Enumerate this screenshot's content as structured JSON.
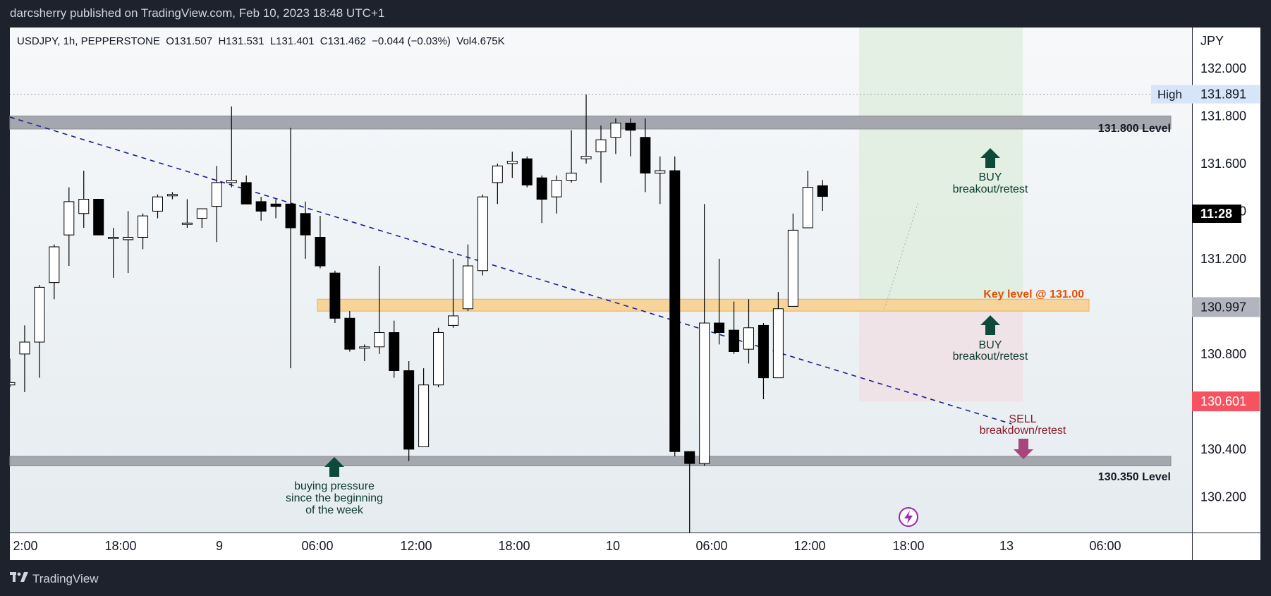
{
  "header": {
    "publisher": "darcsherry published on TradingView.com, Feb 10, 2023 18:48 UTC+1"
  },
  "legend": {
    "symbol": "USDJPY, 1h, PEPPERSTONE",
    "open": "O131.507",
    "high": "H131.531",
    "low": "L131.401",
    "close": "C131.462",
    "change": "−0.044 (−0.03%)",
    "volume": "Vol4.675K"
  },
  "axis": {
    "currency": "JPY",
    "price_ticks": [
      "130.200",
      "130.400",
      "130.800",
      "131.200",
      "131.400",
      "131.600",
      "131.800",
      "132.000"
    ],
    "time_ticks": [
      "2:00",
      "18:00",
      "9",
      "06:00",
      "12:00",
      "18:00",
      "10",
      "06:00",
      "12:00",
      "18:00",
      "13",
      "06:00"
    ]
  },
  "price_badges": [
    {
      "label": "High",
      "value": "131.891",
      "bg": "#d6e5f8",
      "fg": "#131722"
    },
    {
      "value": "11:28",
      "bg": "#000000",
      "fg": "#ffffff"
    },
    {
      "value": "130.997",
      "bg": "#b2b5be",
      "fg": "#131722"
    },
    {
      "value": "130.601",
      "bg": "#f7525f",
      "fg": "#ffffff"
    }
  ],
  "annotations": {
    "level_high": "131.800 Level",
    "level_low": "130.350 Level",
    "key_level": "Key level @ 131.00",
    "buy_top_1": "BUY",
    "buy_top_2": "breakout/retest",
    "buy_mid_1": "BUY",
    "buy_mid_2": "breakout/retest",
    "sell_1": "SELL",
    "sell_2": "breakdown/retest",
    "pressure_1": "buying pressure",
    "pressure_2": "since the beginning",
    "pressure_3": "of the week"
  },
  "footer": {
    "brand": "TradingView"
  },
  "colors": {
    "bull_body": "#ffffff",
    "bear_body": "#000000",
    "zone_gray": "#a4a7ad",
    "key_zone": "#f7d49a",
    "key_text": "#e65100",
    "buy_arrow": "#0d4a3a",
    "sell_arrow": "#a8457a",
    "sell_text": "#8b1a2a",
    "trendline": "#1a1f8c",
    "profit_zone": "#d9ebd6",
    "loss_zone": "#f0e0e3"
  },
  "chart_data": {
    "type": "candlestick",
    "symbol": "USDJPY",
    "interval": "1h",
    "exchange": "PEPPERSTONE",
    "ylim": [
      130.05,
      132.17
    ],
    "candles": [
      {
        "o": 130.67,
        "h": 130.78,
        "l": 130.66,
        "c": 130.68
      },
      {
        "o": 130.8,
        "h": 130.92,
        "l": 130.64,
        "c": 130.85
      },
      {
        "o": 130.85,
        "h": 131.09,
        "l": 130.7,
        "c": 131.08
      },
      {
        "o": 131.1,
        "h": 131.26,
        "l": 131.03,
        "c": 131.25
      },
      {
        "o": 131.3,
        "h": 131.5,
        "l": 131.17,
        "c": 131.44
      },
      {
        "o": 131.39,
        "h": 131.57,
        "l": 131.33,
        "c": 131.45
      },
      {
        "o": 131.45,
        "h": 131.45,
        "l": 131.3,
        "c": 131.3
      },
      {
        "o": 131.29,
        "h": 131.33,
        "l": 131.12,
        "c": 131.29
      },
      {
        "o": 131.28,
        "h": 131.4,
        "l": 131.14,
        "c": 131.29
      },
      {
        "o": 131.29,
        "h": 131.39,
        "l": 131.24,
        "c": 131.38
      },
      {
        "o": 131.4,
        "h": 131.47,
        "l": 131.37,
        "c": 131.46
      },
      {
        "o": 131.47,
        "h": 131.48,
        "l": 131.45,
        "c": 131.47
      },
      {
        "o": 131.35,
        "h": 131.45,
        "l": 131.33,
        "c": 131.35
      },
      {
        "o": 131.37,
        "h": 131.41,
        "l": 131.33,
        "c": 131.41
      },
      {
        "o": 131.42,
        "h": 131.59,
        "l": 131.27,
        "c": 131.52
      },
      {
        "o": 131.52,
        "h": 131.84,
        "l": 131.5,
        "c": 131.53
      },
      {
        "o": 131.52,
        "h": 131.55,
        "l": 131.43,
        "c": 131.43
      },
      {
        "o": 131.44,
        "h": 131.46,
        "l": 131.36,
        "c": 131.4
      },
      {
        "o": 131.43,
        "h": 131.45,
        "l": 131.37,
        "c": 131.42
      },
      {
        "o": 131.43,
        "h": 131.75,
        "l": 130.74,
        "c": 131.33
      },
      {
        "o": 131.39,
        "h": 131.44,
        "l": 131.2,
        "c": 131.3
      },
      {
        "o": 131.29,
        "h": 131.38,
        "l": 131.16,
        "c": 131.17
      },
      {
        "o": 131.14,
        "h": 131.15,
        "l": 130.93,
        "c": 130.95
      },
      {
        "o": 130.95,
        "h": 130.98,
        "l": 130.81,
        "c": 130.82
      },
      {
        "o": 130.83,
        "h": 130.84,
        "l": 130.77,
        "c": 130.83
      },
      {
        "o": 130.83,
        "h": 131.17,
        "l": 130.8,
        "c": 130.89
      },
      {
        "o": 130.89,
        "h": 130.94,
        "l": 130.7,
        "c": 130.73
      },
      {
        "o": 130.73,
        "h": 130.77,
        "l": 130.35,
        "c": 130.4
      },
      {
        "o": 130.41,
        "h": 130.74,
        "l": 130.41,
        "c": 130.67
      },
      {
        "o": 130.67,
        "h": 130.91,
        "l": 130.66,
        "c": 130.89
      },
      {
        "o": 130.92,
        "h": 131.2,
        "l": 130.91,
        "c": 130.96
      },
      {
        "o": 130.99,
        "h": 131.26,
        "l": 130.98,
        "c": 131.17
      },
      {
        "o": 131.15,
        "h": 131.47,
        "l": 131.13,
        "c": 131.46
      },
      {
        "o": 131.52,
        "h": 131.6,
        "l": 131.43,
        "c": 131.59
      },
      {
        "o": 131.6,
        "h": 131.65,
        "l": 131.54,
        "c": 131.61
      },
      {
        "o": 131.62,
        "h": 131.63,
        "l": 131.5,
        "c": 131.51
      },
      {
        "o": 131.54,
        "h": 131.55,
        "l": 131.35,
        "c": 131.45
      },
      {
        "o": 131.46,
        "h": 131.55,
        "l": 131.39,
        "c": 131.53
      },
      {
        "o": 131.53,
        "h": 131.74,
        "l": 131.52,
        "c": 131.56
      },
      {
        "o": 131.62,
        "h": 131.89,
        "l": 131.6,
        "c": 131.63
      },
      {
        "o": 131.65,
        "h": 131.76,
        "l": 131.52,
        "c": 131.7
      },
      {
        "o": 131.71,
        "h": 131.79,
        "l": 131.64,
        "c": 131.77
      },
      {
        "o": 131.77,
        "h": 131.79,
        "l": 131.63,
        "c": 131.74
      },
      {
        "o": 131.71,
        "h": 131.79,
        "l": 131.48,
        "c": 131.56
      },
      {
        "o": 131.56,
        "h": 131.63,
        "l": 131.43,
        "c": 131.57
      },
      {
        "o": 131.57,
        "h": 131.63,
        "l": 130.37,
        "c": 130.39
      },
      {
        "o": 130.39,
        "h": 130.39,
        "l": 130.05,
        "c": 130.34
      },
      {
        "o": 130.34,
        "h": 131.43,
        "l": 130.33,
        "c": 130.93
      },
      {
        "o": 130.93,
        "h": 131.2,
        "l": 130.84,
        "c": 130.89
      },
      {
        "o": 130.9,
        "h": 131.02,
        "l": 130.8,
        "c": 130.81
      },
      {
        "o": 130.82,
        "h": 131.03,
        "l": 130.76,
        "c": 130.91
      },
      {
        "o": 130.92,
        "h": 130.93,
        "l": 130.61,
        "c": 130.7
      },
      {
        "o": 130.7,
        "h": 131.06,
        "l": 130.7,
        "c": 130.99
      },
      {
        "o": 131.0,
        "h": 131.39,
        "l": 131.0,
        "c": 131.32
      },
      {
        "o": 131.33,
        "h": 131.57,
        "l": 131.33,
        "c": 131.5
      },
      {
        "o": 131.507,
        "h": 131.531,
        "l": 131.401,
        "c": 131.462
      }
    ],
    "zones": [
      {
        "name": "131.800 Level",
        "from": 131.745,
        "to": 131.8
      },
      {
        "name": "130.350 Level",
        "from": 130.33,
        "to": 130.37
      },
      {
        "name": "Key level @ 131.00",
        "from": 130.98,
        "to": 131.03
      }
    ],
    "trendline": {
      "style": "dashed"
    },
    "position": {
      "entry": 130.997,
      "target": 131.891,
      "stop": 130.601
    },
    "legend_position": "top-left"
  }
}
